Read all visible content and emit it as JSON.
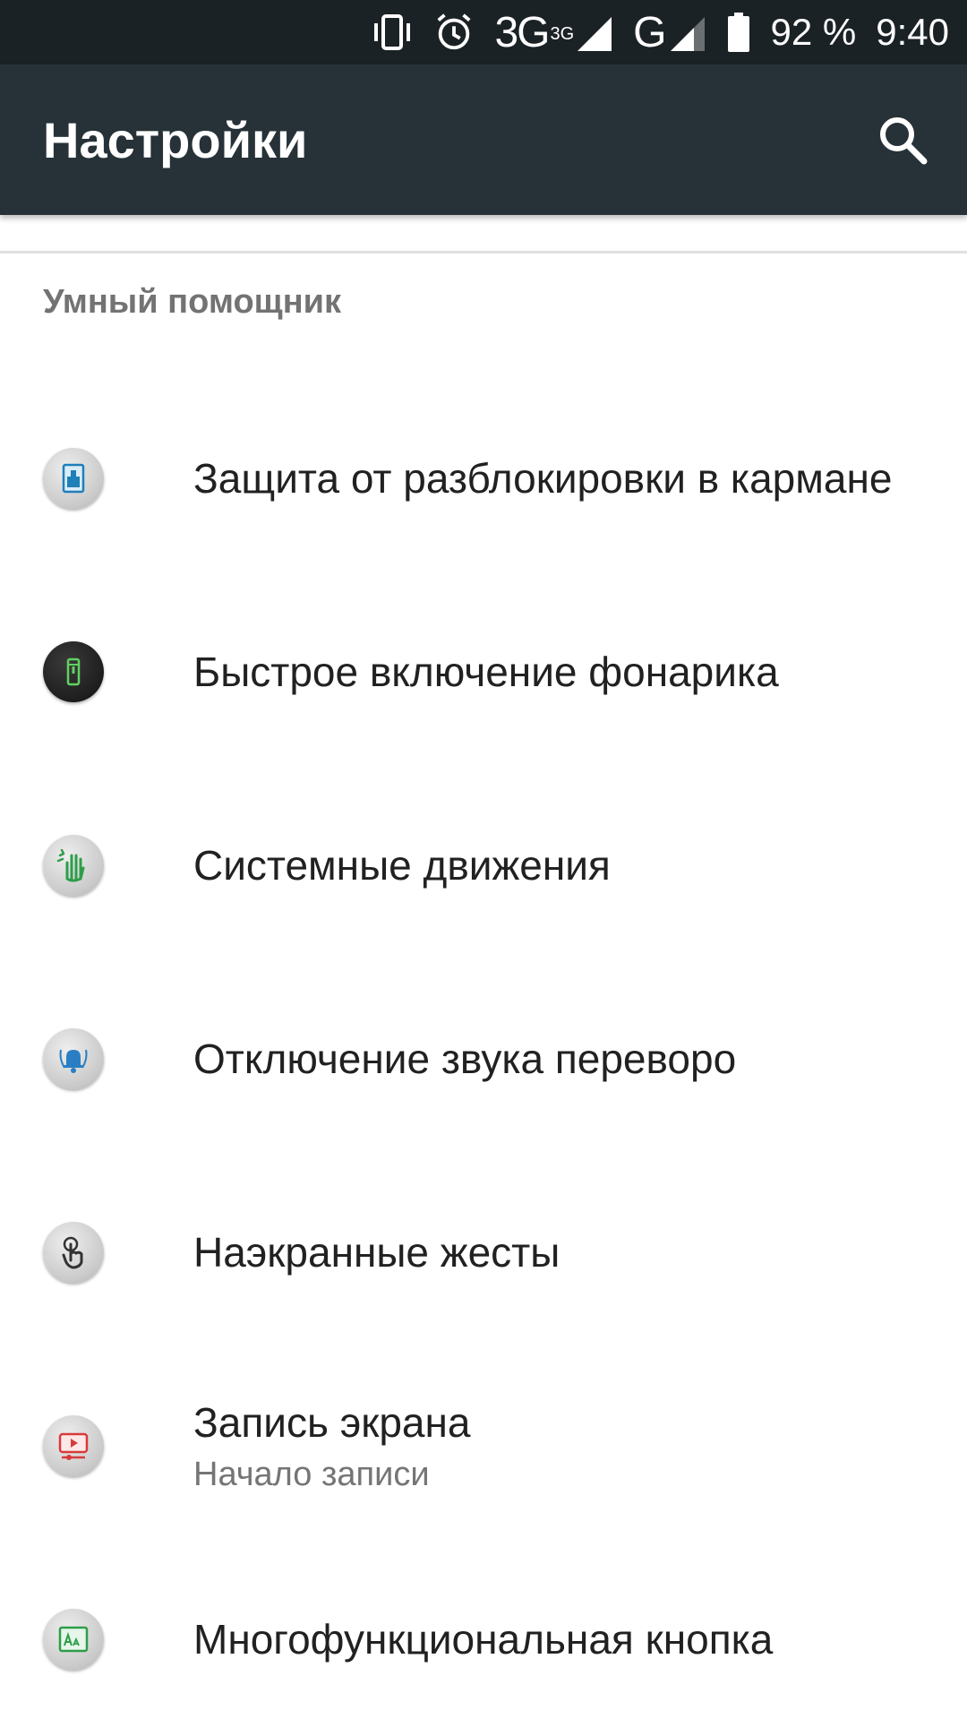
{
  "statusbar": {
    "icons": [
      "vibrate-icon",
      "alarm-icon",
      "signal-3g-icon",
      "signal-g-icon",
      "battery-icon"
    ],
    "network_3g": "3G",
    "network_3g_sup": "3G",
    "network_g": "G",
    "battery": "92 %",
    "time": "9:40"
  },
  "appbar": {
    "title": "Настройки",
    "search_icon": "search-icon"
  },
  "section": {
    "title": "Умный помощник"
  },
  "items": [
    {
      "label": "Защита от разблокировки в кармане",
      "icon": "pocket-lock-icon"
    },
    {
      "label": "Быстрое включение фонарика",
      "icon": "flashlight-icon"
    },
    {
      "label": "Системные движения",
      "icon": "hand-gesture-icon"
    },
    {
      "label": "Отключение звука переворо",
      "icon": "flip-mute-icon"
    },
    {
      "label": "Наэкранные жесты",
      "icon": "touch-gesture-icon"
    },
    {
      "label": "Запись экрана",
      "sublabel": "Начало записи",
      "icon": "screen-record-icon"
    },
    {
      "label": "Многофункциональная кнопка",
      "icon": "multifunction-button-icon"
    }
  ],
  "colors": {
    "statusbar": "#1b2226",
    "appbar": "#263238",
    "section_title": "#737373",
    "text": "#212121",
    "subtext": "#757575"
  }
}
